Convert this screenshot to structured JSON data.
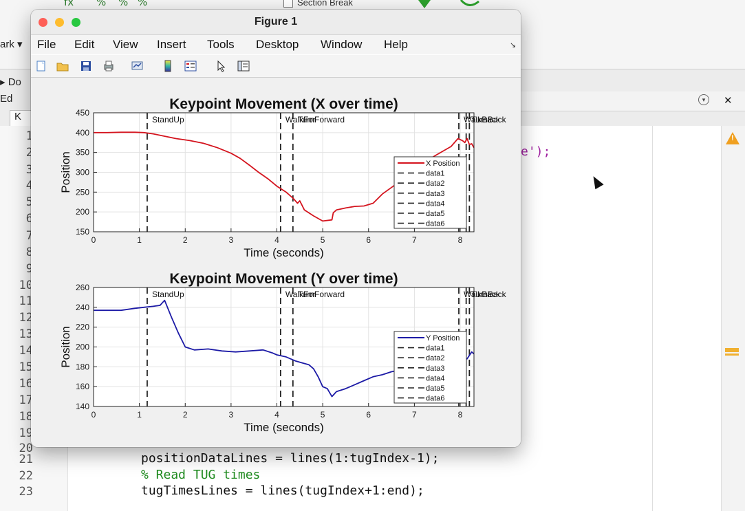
{
  "background": {
    "toolstrip_glyphs": [
      "fx",
      "%",
      "%",
      "%"
    ],
    "section_break_label": "Section Break",
    "mark_label": "ark ▾",
    "do_label": "▸ Do",
    "ed_label": "Ed",
    "editor_tab_label": "K",
    "code_fragment": "e');",
    "code_lines": [
      {
        "num": "21",
        "text": "positionDataLines = lines(1:tugIndex-1);",
        "comment": false
      },
      {
        "num": "22",
        "text": "% Read TUG times",
        "comment": true
      },
      {
        "num": "23",
        "text": "tugTimesLines = lines(tugIndex+1:end);",
        "comment": false
      }
    ],
    "gutter_numbers": [
      "1",
      "2",
      "3",
      "4",
      "5",
      "6",
      "7",
      "8",
      "9",
      "10",
      "11",
      "12",
      "13",
      "14",
      "15",
      "16",
      "17",
      "18",
      "19",
      "20"
    ]
  },
  "figure": {
    "title": "Figure 1",
    "menu": [
      "File",
      "Edit",
      "View",
      "Insert",
      "Tools",
      "Desktop",
      "Window",
      "Help"
    ],
    "toolbar_icons": [
      "new-figure-icon",
      "open-file-icon",
      "save-icon",
      "print-icon",
      "link-plot-icon",
      "colorbar-icon",
      "legend-icon",
      "pointer-icon",
      "property-editor-icon"
    ],
    "colors": {
      "x_series": "#d4141e",
      "y_series": "#1c1aa6",
      "event_line": "#222222",
      "traffic_red": "#fe5f57",
      "traffic_yellow": "#febc2e",
      "traffic_green": "#28c840"
    }
  },
  "chart_data": [
    {
      "type": "line",
      "title": "Keypoint Movement (X over time)",
      "xlabel": "Time (seconds)",
      "ylabel": "Position",
      "xlim": [
        0,
        8.3
      ],
      "ylim": [
        150,
        450
      ],
      "xticks": [
        0,
        1,
        2,
        3,
        4,
        5,
        6,
        7,
        8
      ],
      "yticks": [
        150,
        200,
        250,
        300,
        350,
        400,
        450
      ],
      "grid": true,
      "legend_position": "lower-right",
      "legend": [
        "X Position",
        "data1",
        "data2",
        "data3",
        "data4",
        "data5",
        "data6"
      ],
      "series": [
        {
          "name": "X Position",
          "x": [
            0,
            0.3,
            0.6,
            0.9,
            1.1,
            1.3,
            1.5,
            1.8,
            2.1,
            2.4,
            2.7,
            3.0,
            3.2,
            3.4,
            3.6,
            3.8,
            4.0,
            4.2,
            4.35,
            4.45,
            4.5,
            4.6,
            4.8,
            5.0,
            5.2,
            5.23,
            5.3,
            5.5,
            5.7,
            5.9,
            6.1,
            6.3,
            6.6,
            6.9,
            7.2,
            7.5,
            7.8,
            7.95,
            8.05,
            8.1,
            8.15,
            8.2,
            8.25,
            8.3
          ],
          "y": [
            400,
            400,
            401,
            401,
            400,
            397,
            392,
            385,
            380,
            373,
            362,
            348,
            335,
            318,
            300,
            284,
            265,
            250,
            235,
            222,
            228,
            205,
            190,
            177,
            180,
            198,
            205,
            210,
            214,
            215,
            222,
            245,
            270,
            300,
            325,
            345,
            365,
            385,
            380,
            375,
            385,
            370,
            372,
            362
          ]
        }
      ],
      "events": [
        {
          "name": "data1",
          "x": 1.17,
          "label": "StandUp"
        },
        {
          "name": "data2",
          "x": 4.08,
          "label": "WalkFor"
        },
        {
          "name": "data3",
          "x": 4.35,
          "label": "TurnForward"
        },
        {
          "name": "data4",
          "x": 7.97,
          "label": "WalkBack"
        },
        {
          "name": "data5",
          "x": 8.13,
          "label": "TurnBack"
        },
        {
          "name": "data6",
          "x": 8.2,
          "label": ""
        }
      ]
    },
    {
      "type": "line",
      "title": "Keypoint Movement (Y over time)",
      "xlabel": "Time (seconds)",
      "ylabel": "Position",
      "xlim": [
        0,
        8.3
      ],
      "ylim": [
        140,
        260
      ],
      "xticks": [
        0,
        1,
        2,
        3,
        4,
        5,
        6,
        7,
        8
      ],
      "yticks": [
        140,
        160,
        180,
        200,
        220,
        240,
        260
      ],
      "grid": true,
      "legend_position": "lower-right",
      "legend": [
        "Y Position",
        "data1",
        "data2",
        "data3",
        "data4",
        "data5",
        "data6"
      ],
      "series": [
        {
          "name": "Y Position",
          "x": [
            0,
            0.3,
            0.6,
            0.9,
            1.1,
            1.3,
            1.45,
            1.55,
            1.7,
            1.85,
            2.0,
            2.2,
            2.5,
            2.8,
            3.1,
            3.4,
            3.7,
            3.9,
            4.0,
            4.2,
            4.4,
            4.55,
            4.7,
            4.8,
            4.9,
            5.0,
            5.1,
            5.2,
            5.3,
            5.5,
            5.7,
            5.9,
            6.1,
            6.3,
            6.5,
            6.8,
            7.1,
            7.4,
            7.7,
            7.9,
            8.05,
            8.15,
            8.25,
            8.3
          ],
          "y": [
            237,
            237,
            237,
            239,
            240,
            241,
            242,
            247,
            230,
            214,
            200,
            197,
            198,
            196,
            195,
            196,
            197,
            194,
            192,
            190,
            186,
            184,
            182,
            178,
            170,
            160,
            158,
            150,
            155,
            158,
            162,
            166,
            170,
            172,
            175,
            178,
            180,
            183,
            186,
            189,
            192,
            188,
            195,
            193
          ]
        }
      ],
      "events": [
        {
          "name": "data1",
          "x": 1.17,
          "label": "StandUp"
        },
        {
          "name": "data2",
          "x": 4.08,
          "label": "WalkFor"
        },
        {
          "name": "data3",
          "x": 4.35,
          "label": "TurnForward"
        },
        {
          "name": "data4",
          "x": 7.97,
          "label": "WalkBack"
        },
        {
          "name": "data5",
          "x": 8.13,
          "label": "TurnBack"
        },
        {
          "name": "data6",
          "x": 8.2,
          "label": ""
        }
      ]
    }
  ]
}
